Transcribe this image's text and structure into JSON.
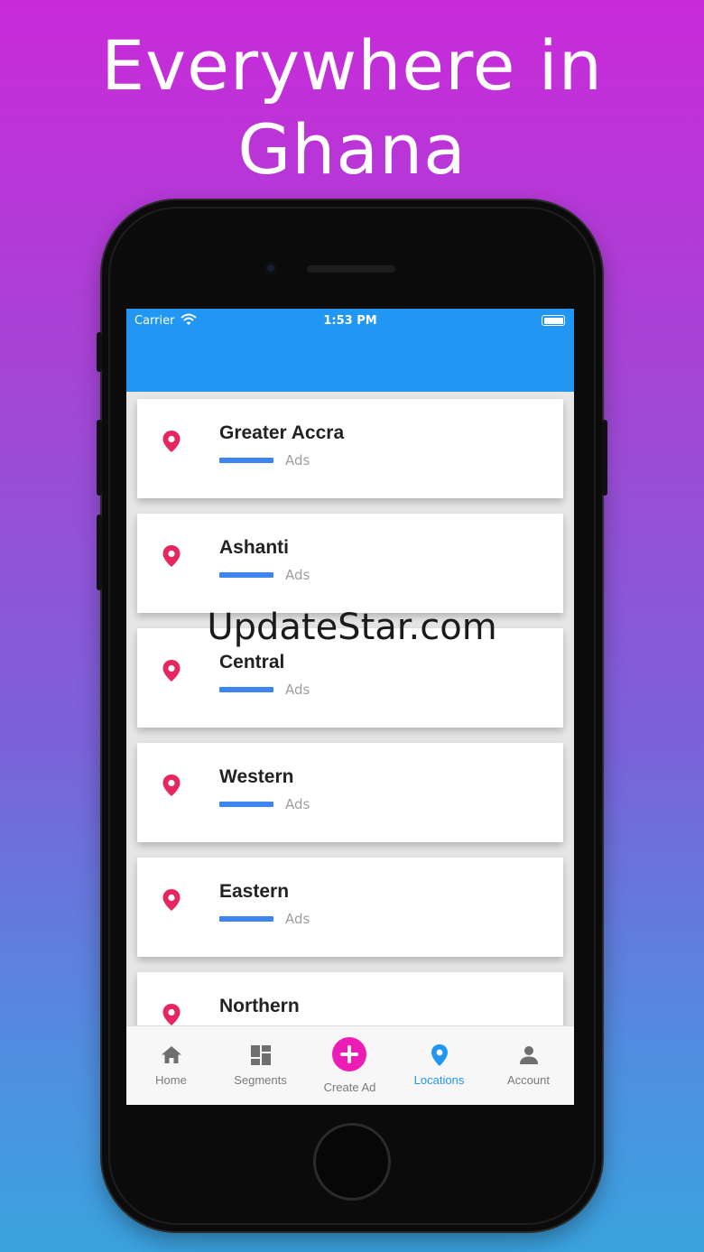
{
  "headline": {
    "line1": "Everywhere in",
    "line2": "Ghana"
  },
  "status_bar": {
    "carrier": "Carrier",
    "time": "1:53 PM"
  },
  "regions": [
    {
      "name": "Greater Accra",
      "ads_label": "Ads"
    },
    {
      "name": "Ashanti",
      "ads_label": "Ads"
    },
    {
      "name": "Central",
      "ads_label": "Ads"
    },
    {
      "name": "Western",
      "ads_label": "Ads"
    },
    {
      "name": "Eastern",
      "ads_label": "Ads"
    },
    {
      "name": "Northern",
      "ads_label": ""
    }
  ],
  "tabs": [
    {
      "label": "Home",
      "icon": "home-icon"
    },
    {
      "label": "Segments",
      "icon": "segments-icon"
    },
    {
      "label": "Create Ad",
      "icon": "plus-icon"
    },
    {
      "label": "Locations",
      "icon": "location-pin-icon",
      "active": true
    },
    {
      "label": "Account",
      "icon": "account-icon"
    }
  ],
  "watermark": "UpdateStar.com",
  "colors": {
    "app_bar": "#2196f3",
    "pin": "#e8265e",
    "bar": "#3d86f0",
    "create_button": "#ee1cb7",
    "active_tab": "#2196f3"
  }
}
